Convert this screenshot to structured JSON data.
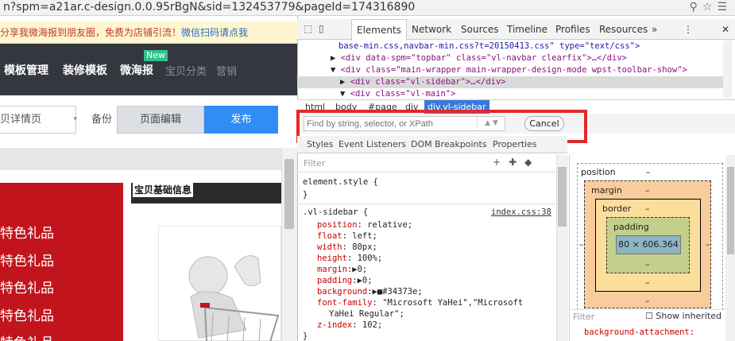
{
  "url": "n?spm=a21ar.c-design.0.0.95rBgN&sid=132453779&pageId=174316890",
  "promo": {
    "text": "分享我微海报到朋友圈，免费为店铺引流！",
    "link": "微信扫码请点我"
  },
  "nav": {
    "items": [
      "模板管理",
      "装修模板",
      "微海报"
    ],
    "new_badge": "New",
    "dim_items": [
      "宝贝分类",
      "营销"
    ]
  },
  "toolbar": {
    "page_select": "贝详情页",
    "backup": "备份",
    "edit": "页面编辑",
    "publish": "发布"
  },
  "sidebar_items": [
    "特色礼品",
    "特色礼品",
    "特色礼品",
    "特色礼品",
    "特色礼品"
  ],
  "info_title": "宝贝基础信息",
  "devtools": {
    "tabs": [
      "Elements",
      "Network",
      "Sources",
      "Timeline",
      "Profiles",
      "Resources"
    ],
    "more": "»",
    "close": "✕",
    "dom": [
      {
        "indent": "",
        "text": "base-min.css,navbar-min.css?t=20150413.css\" type=\"text/css\">"
      },
      {
        "indent": "▶ ",
        "text": "<div data-spm=\"topbar\" class=\"vl-navbar clearfix\">…</div>"
      },
      {
        "indent": "▼ ",
        "text": "<div class=\"main-wrapper main-wrapper-design-mode wpst-toolbar-show\">"
      },
      {
        "indent": "▶ ",
        "text": "<div class=\"vl-sidebar\">…</div>"
      },
      {
        "indent": "▼ ",
        "text": "<div class=\"vl-main\">"
      }
    ],
    "breadcrumbs": [
      "html",
      "body",
      "#page",
      "div",
      "div.vl-sidebar"
    ],
    "search": {
      "placeholder": "Find by string, selector, or XPath",
      "cancel": "Cancel"
    },
    "subtabs": [
      "Styles",
      "Event Listeners",
      "DOM Breakpoints",
      "Properties"
    ],
    "filter_placeholder": "Filter",
    "styles": {
      "element_style": "element.style {",
      "close_brace": "}",
      "rule_selector": ".vl-sidebar {",
      "rule_source": "index.css:38",
      "props": [
        {
          "name": "position",
          "value": "relative;"
        },
        {
          "name": "float",
          "value": "left;"
        },
        {
          "name": "width",
          "value": "80px;"
        },
        {
          "name": "height",
          "value": "100%;"
        },
        {
          "name": "margin",
          "value": "▶0;"
        },
        {
          "name": "padding",
          "value": "▶0;"
        },
        {
          "name": "background",
          "value": "▶■#34373e;"
        },
        {
          "name": "font-family",
          "value": "\"Microsoft YaHei\",\"Microsoft"
        },
        {
          "name": "",
          "value": "YaHei Regular\";"
        },
        {
          "name": "z-index",
          "value": "102;"
        }
      ]
    },
    "metrics": {
      "position": "position",
      "margin": "margin",
      "border": "border",
      "padding": "padding",
      "content": "80 × 606.364",
      "dash": "–",
      "filter": "Filter",
      "show_inherited": "Show inherited",
      "computed": "background-attachment:"
    }
  }
}
